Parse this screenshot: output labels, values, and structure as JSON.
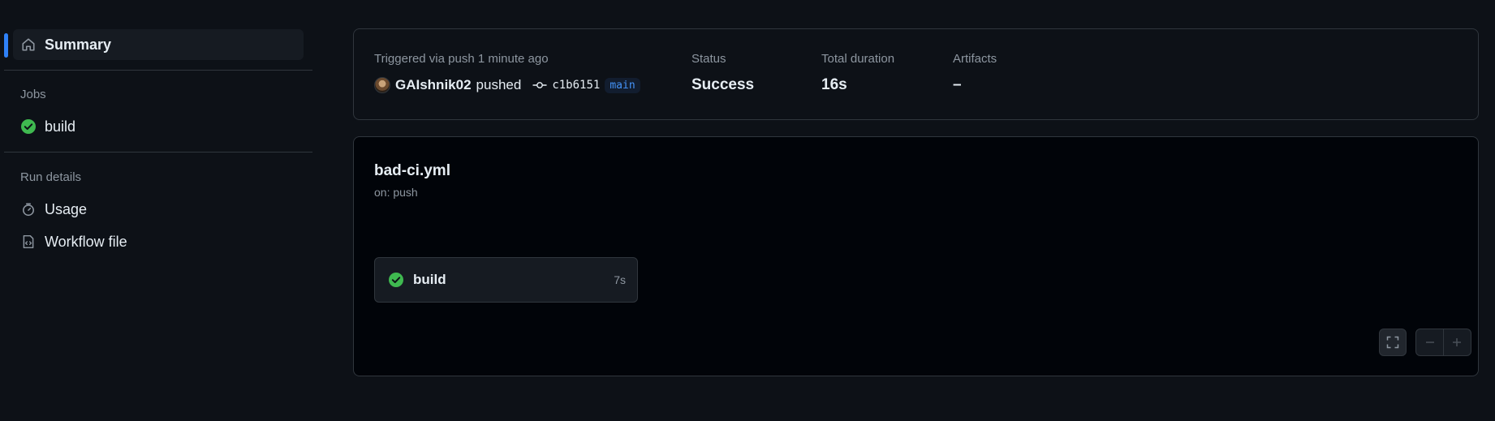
{
  "sidebar": {
    "summary_label": "Summary",
    "jobs_title": "Jobs",
    "jobs": [
      {
        "label": "build",
        "status": "success"
      }
    ],
    "run_details_title": "Run details",
    "run_details": [
      {
        "label": "Usage",
        "icon": "stopwatch-icon"
      },
      {
        "label": "Workflow file",
        "icon": "file-code-icon"
      }
    ]
  },
  "summary": {
    "trigger_text": "Triggered via push 1 minute ago",
    "user": "GAIshnik02",
    "action": "pushed",
    "commit_sha": "c1b6151",
    "branch": "main",
    "status_label": "Status",
    "status_value": "Success",
    "duration_label": "Total duration",
    "duration_value": "16s",
    "artifacts_label": "Artifacts",
    "artifacts_value": "–"
  },
  "workflow": {
    "name": "bad-ci.yml",
    "trigger": "on: push",
    "job": {
      "label": "build",
      "duration": "7s"
    }
  },
  "colors": {
    "success": "#3fb950",
    "accent": "#2f81f7",
    "background": "#0d1117"
  }
}
